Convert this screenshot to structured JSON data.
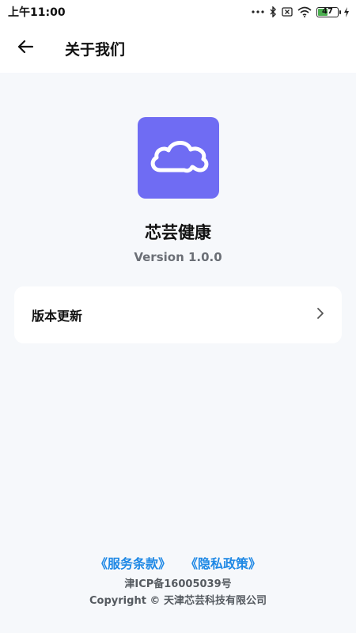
{
  "status_bar": {
    "time": "上午11:00",
    "battery_level": "47",
    "battery_fraction": 0.47,
    "icons": [
      "more-dots-icon",
      "bluetooth-icon",
      "sim-blocked-icon",
      "wifi-icon",
      "battery-icon",
      "charging-icon"
    ]
  },
  "app_bar": {
    "back_icon": "arrow-left-icon",
    "title": "关于我们"
  },
  "app_info": {
    "logo_icon": "cloud-icon",
    "logo_color": "#6f6cf3",
    "name": "芯芸健康",
    "version": "Version 1.0.0"
  },
  "settings": {
    "update_label": "版本更新",
    "update_icon": "chevron-right-icon"
  },
  "footer": {
    "terms_link": "《服务条款》",
    "privacy_link": "《隐私政策》",
    "link_color": "#1e88e5",
    "icp": "津ICP备16005039号",
    "copyright": "Copyright © 天津芯芸科技有限公司"
  }
}
